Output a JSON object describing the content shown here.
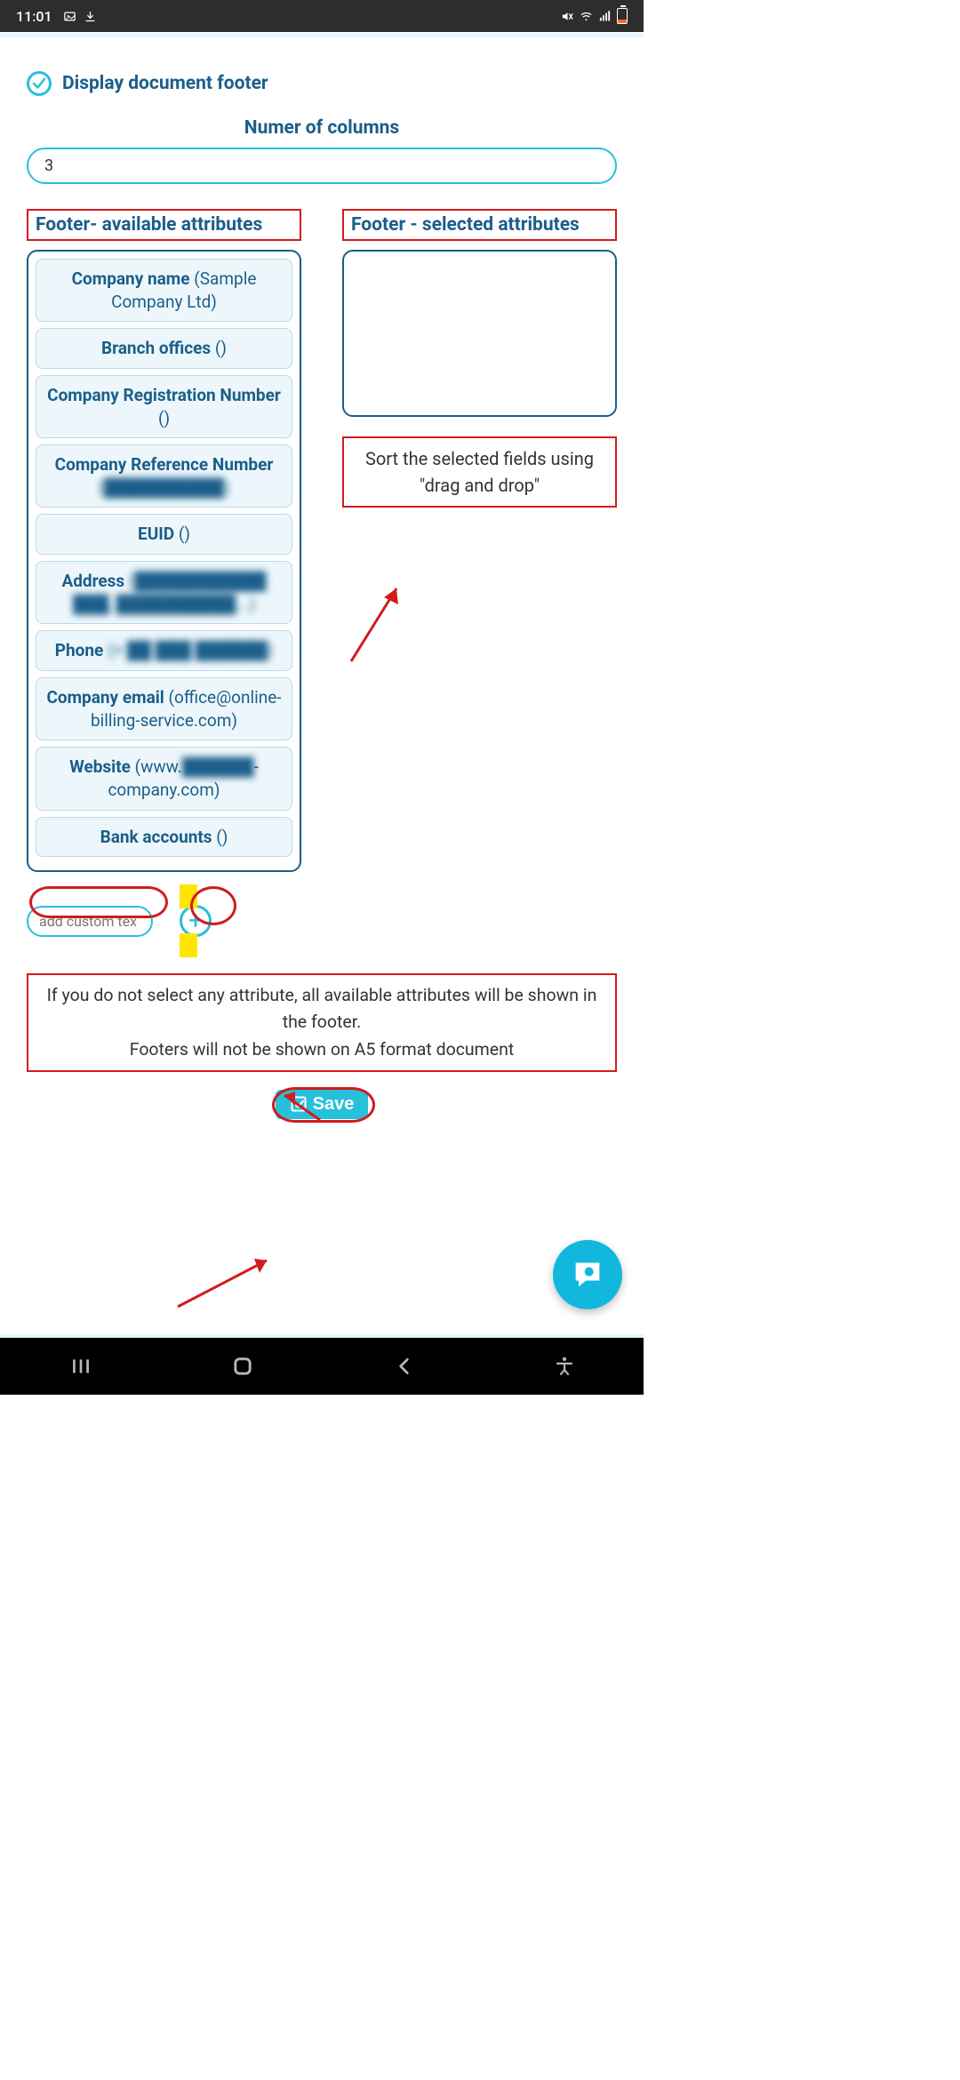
{
  "status_bar": {
    "time": "11:01"
  },
  "header": {
    "display_footer_label": "Display document footer"
  },
  "columns_section": {
    "label": "Numer of columns",
    "value": "3"
  },
  "available": {
    "header": "Footer- available attributes",
    "items": [
      {
        "label": "Company name",
        "value": "(Sample Company Ltd)",
        "blur": false
      },
      {
        "label": "Branch offices",
        "value": "()",
        "blur": false
      },
      {
        "label": "Company Registration Number",
        "value": "()",
        "blur": false
      },
      {
        "label": "Company Reference Number",
        "value": "(██████████)",
        "blur": true
      },
      {
        "label": "EUID",
        "value": "()",
        "blur": false
      },
      {
        "label": "Address",
        "value": "(███████████ ███, ██████████...)",
        "blur": true
      },
      {
        "label": "Phone",
        "value": "(+ ██ ███ ██████)",
        "blur": true
      },
      {
        "label": "Company email",
        "value": "(office@online-billing-service.com)",
        "blur": false
      },
      {
        "label": "Website",
        "value_prefix": "(www.",
        "value_blurred": "██████",
        "value_suffix": "-company.com)",
        "blur": "partial"
      },
      {
        "label": "Bank accounts",
        "value": "()",
        "blur": false
      }
    ]
  },
  "selected": {
    "header": "Footer - selected attributes"
  },
  "sort_note": "Sort the selected fields using \"drag and drop\"",
  "custom_text": {
    "placeholder": "add custom tex"
  },
  "info_line1": "If you do not select any attribute, all available attributes will be shown in the footer.",
  "info_line2": "Footers will not be shown on A5 format document",
  "save_label": "Save"
}
